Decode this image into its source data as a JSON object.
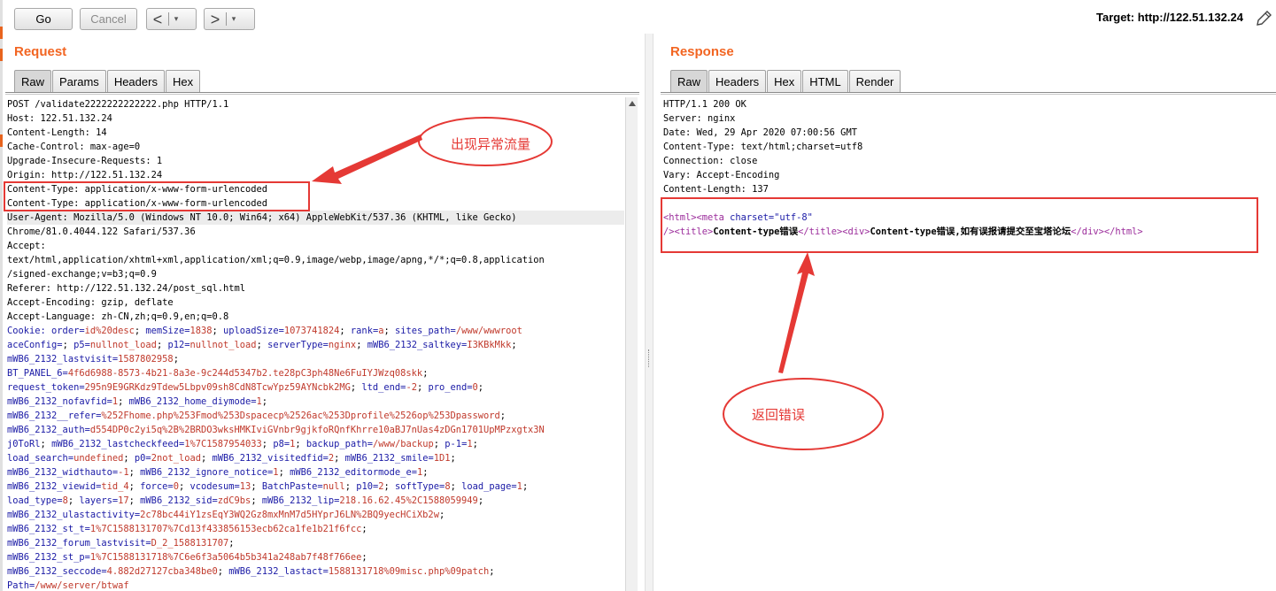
{
  "toolbar": {
    "go_label": "Go",
    "cancel_label": "Cancel",
    "back_arrow": "<",
    "forward_arrow": ">",
    "dropdown_glyph": "▾",
    "target": "Target: http://122.51.132.24",
    "edit_icon": "pencil-icon"
  },
  "request": {
    "title": "Request",
    "tabs": [
      "Raw",
      "Params",
      "Headers",
      "Hex"
    ],
    "active_tab": "Raw",
    "lines": [
      "POST /validate2222222222222.php HTTP/1.1",
      "Host: 122.51.132.24",
      "Content-Length: 14",
      "Cache-Control: max-age=0",
      "Upgrade-Insecure-Requests: 1",
      "Origin: http://122.51.132.24",
      "Content-Type: application/x-www-form-urlencoded",
      "Content-Type: application/x-www-form-urlencoded",
      "User-Agent: Mozilla/5.0 (Windows NT 10.0; Win64; x64) AppleWebKit/537.36 (KHTML, like Gecko)",
      "Chrome/81.0.4044.122 Safari/537.36",
      "Accept:",
      "text/html,application/xhtml+xml,application/xml;q=0.9,image/webp,image/apng,*/*;q=0.8,application",
      "/signed-exchange;v=b3;q=0.9",
      "Referer: http://122.51.132.24/post_sql.html",
      "Accept-Encoding: gzip, deflate",
      "Accept-Language: zh-CN,zh;q=0.9,en;q=0.8"
    ],
    "cookie_lines": [
      "Cookie: order=id%20desc; memSize=1838; uploadSize=1073741824; rank=a; sites_path=/www/wwwroot",
      "aceConfig=; p5=nullnot_load; p12=nullnot_load; serverType=nginx; mWB6_2132_saltkey=I3KBkMkk;",
      "mWB6_2132_lastvisit=1587802958;",
      "BT_PANEL_6=4f6d6988-8573-4b21-8a3e-9c244d5347b2.te28pC3ph48Ne6FuIYJWzq08skk;",
      "request_token=295n9E9GRKdz9Tdew5Lbpv09sh8CdN8TcwYpz59AYNcbk2MG; ltd_end=-2; pro_end=0;",
      "mWB6_2132_nofavfid=1; mWB6_2132_home_diymode=1;",
      "mWB6_2132__refer=%252Fhome.php%253Fmod%253Dspacecp%2526ac%253Dprofile%2526op%253Dpassword;",
      "mWB6_2132_auth=d554DP0c2yi5q%2B%2BRDO3wksHMKIviGVnbr9gjkfoRQnfKhrre10aBJ7nUas4zDGn1701UpMPzxgtx3N",
      "j0ToRl; mWB6_2132_lastcheckfeed=1%7C1587954033; p8=1; backup_path=/www/backup; p-1=1;",
      "load_search=undefined; p0=2not_load; mWB6_2132_visitedfid=2; mWB6_2132_smile=1D1;",
      "mWB6_2132_widthauto=-1; mWB6_2132_ignore_notice=1; mWB6_2132_editormode_e=1;",
      "mWB6_2132_viewid=tid_4; force=0; vcodesum=13; BatchPaste=null; p10=2; softType=8; load_page=1;",
      "load_type=8; layers=17; mWB6_2132_sid=zdC9bs; mWB6_2132_lip=218.16.62.45%2C1588059949;",
      "mWB6_2132_ulastactivity=2c78bc44iY1zsEqY3WQ2Gz8mxMnM7d5HYprJ6LN%2BQ9yecHCiXb2w;",
      "mWB6_2132_st_t=1%7C1588131707%7Cd13f433856153ecb62ca1fe1b21f6fcc;",
      "mWB6_2132_forum_lastvisit=D_2_1588131707;",
      "mWB6_2132_st_p=1%7C1588131718%7C6e6f3a5064b5b341a248ab7f48f766ee;",
      "mWB6_2132_seccode=4.882d27127cba348be0; mWB6_2132_lastact=1588131718%09misc.php%09patch;",
      "Path=/www/server/btwaf"
    ]
  },
  "response": {
    "title": "Response",
    "tabs": [
      "Raw",
      "Headers",
      "Hex",
      "HTML",
      "Render"
    ],
    "active_tab": "Raw",
    "lines": [
      "HTTP/1.1 200 OK",
      "Server: nginx",
      "Date: Wed, 29 Apr 2020 07:00:56 GMT",
      "Content-Type: text/html;charset=utf8",
      "Connection: close",
      "Vary: Accept-Encoding",
      "Content-Length: 137"
    ],
    "body": {
      "html_open": "<html>",
      "meta_open": "<meta",
      "charset_attr": "charset=",
      "charset_val": "\"utf-8\"",
      "meta_close": "/>",
      "title_open": "<title>",
      "title_text": "Content-type错误",
      "title_close": "</title>",
      "div_open": "<div>",
      "div_text": "Content-type错误,如有误报请提交至宝塔论坛",
      "div_close": "</div>",
      "html_close": "</html>"
    }
  },
  "annotations": {
    "request_note": "出现异常流量",
    "response_note": "返回错误",
    "accent_color": "#e53935"
  }
}
